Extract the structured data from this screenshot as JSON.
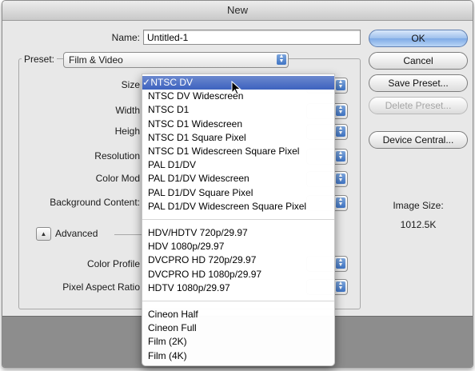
{
  "window": {
    "title": "New"
  },
  "form": {
    "name_label": "Name:",
    "name_value": "Untitled-1",
    "preset_label": "Preset:",
    "preset_value": "Film & Video",
    "size_label": "Size",
    "width_label": "Width",
    "height_label": "Heigh",
    "resolution_label": "Resolution",
    "color_mode_label": "Color Mod",
    "background_label": "Background Content:",
    "advanced_label": "Advanced",
    "color_profile_label": "Color Profile",
    "pixel_aspect_label": "Pixel Aspect Ratio"
  },
  "buttons": {
    "ok": "OK",
    "cancel": "Cancel",
    "save_preset": "Save Preset...",
    "delete_preset": "Delete Preset...",
    "device_central": "Device Central..."
  },
  "image_size": {
    "label": "Image Size:",
    "value": "1012.5K"
  },
  "size_menu": {
    "selected_index": 0,
    "check_mark": "✓",
    "groups": [
      [
        "NTSC DV",
        "NTSC DV Widescreen",
        "NTSC D1",
        "NTSC D1 Widescreen",
        "NTSC D1 Square Pixel",
        "NTSC D1 Widescreen Square Pixel",
        "PAL D1/DV",
        "PAL D1/DV Widescreen",
        "PAL D1/DV Square Pixel",
        "PAL D1/DV Widescreen Square Pixel"
      ],
      [
        "HDV/HDTV 720p/29.97",
        "HDV 1080p/29.97",
        "DVCPRO HD 720p/29.97",
        "DVCPRO HD 1080p/29.97",
        "HDTV 1080p/29.97"
      ],
      [
        "Cineon Half",
        "Cineon Full",
        "Film (2K)",
        "Film (4K)"
      ]
    ]
  }
}
